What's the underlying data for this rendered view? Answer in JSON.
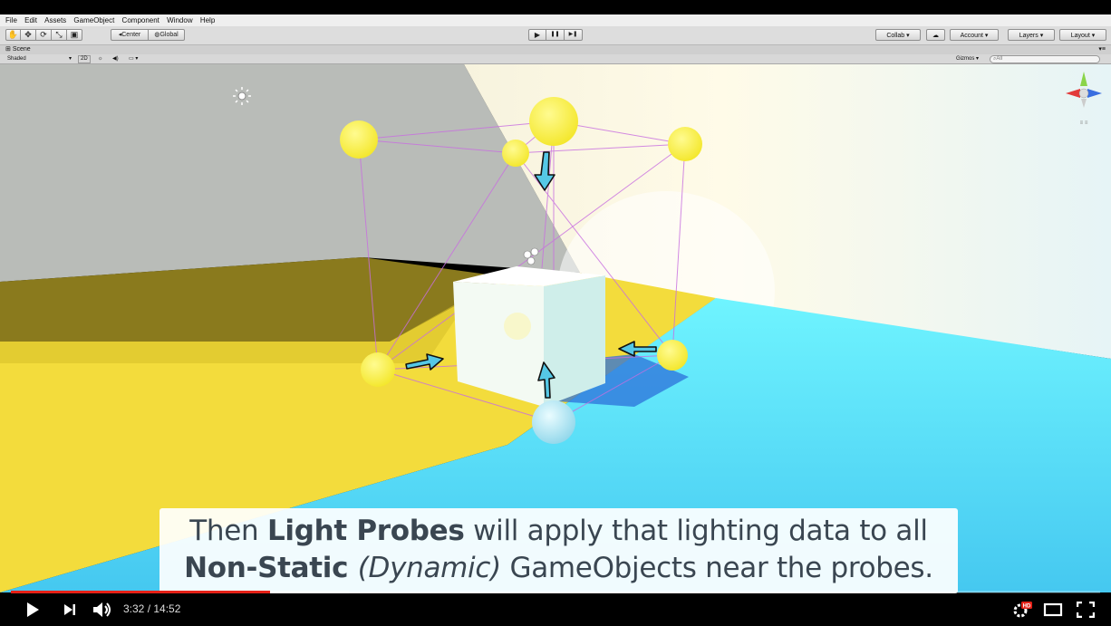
{
  "menu": [
    "File",
    "Edit",
    "Assets",
    "GameObject",
    "Component",
    "Window",
    "Help"
  ],
  "toolbar": {
    "tools": [
      "✋",
      "✥",
      "⟳",
      "⤡",
      "▣"
    ],
    "pivot_label": "Center",
    "space_label": "Global",
    "play": "▶",
    "pause": "❚❚",
    "step": "▶❚",
    "collab_label": "Collab ▾",
    "cloud": "☁",
    "account_label": "Account",
    "layers_label": "Layers",
    "layout_label": "Layout"
  },
  "scene": {
    "tab_label": "Scene",
    "shading_mode": "Shaded",
    "mode_2d": "2D",
    "gizmos_label": "Gizmos",
    "search_placeholder": "All"
  },
  "caption": {
    "line1_pre": "Then ",
    "line1_bold": "Light Probes",
    "line1_post": " will apply that lighting data to all",
    "line2_bold": "Non-Static ",
    "line2_italic": "(Dynamic)",
    "line2_post": " GameObjects near the probes."
  },
  "player": {
    "current_time": "3:32",
    "duration": "14:52",
    "time_display": "3:32 / 14:52",
    "played_fraction": 0.238,
    "buffered_fraction": 0.31,
    "progress_color": "#e52117",
    "hd_badge": "HD"
  },
  "colors": {
    "floor_yellow": "#f6e04a",
    "floor_cyan": "#56dcf4",
    "probe_yellow": "#fff35a",
    "probe_edge": "#c86ee0",
    "arrow_fill": "#55c8e6"
  }
}
